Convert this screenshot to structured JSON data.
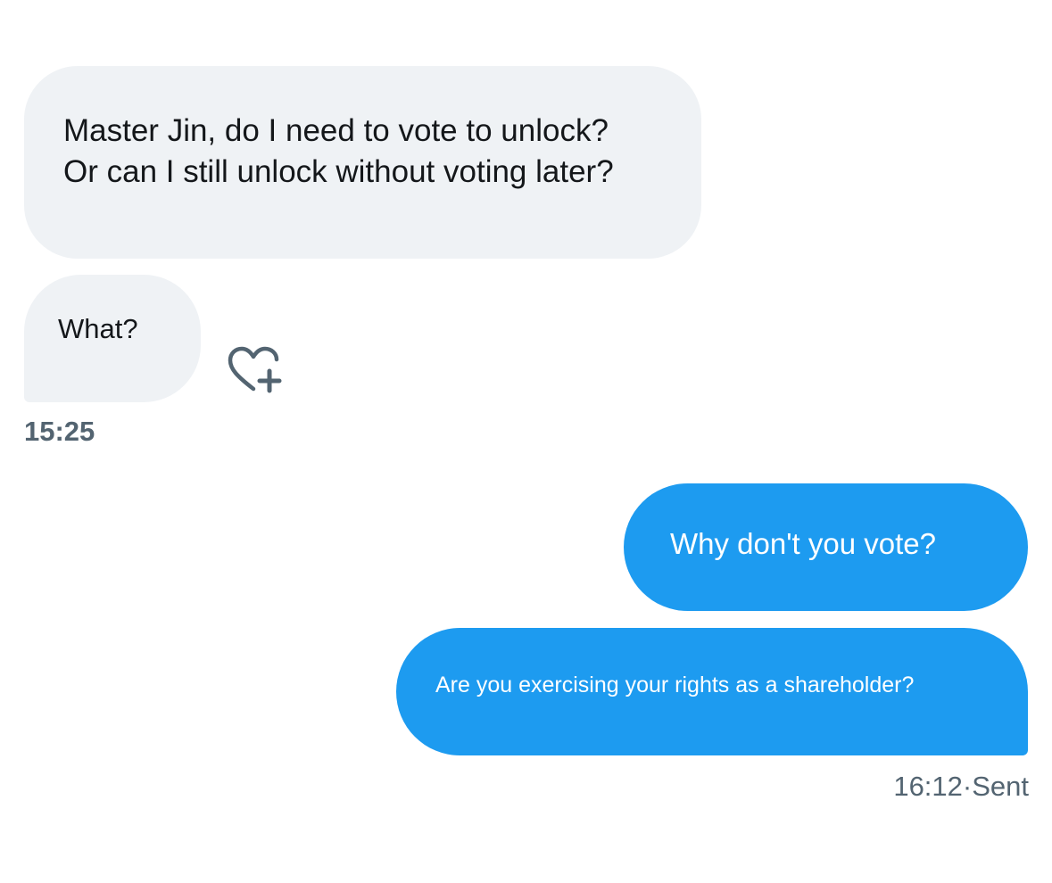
{
  "messages": [
    {
      "direction": "received",
      "text": "Master Jin, do I need to vote to unlock?\nOr can I still unlock without voting later?"
    },
    {
      "direction": "received",
      "text": "What?"
    },
    {
      "direction": "sent",
      "text": "Why don't you vote?"
    },
    {
      "direction": "sent",
      "text": "Are you exercising your rights as a shareholder?"
    }
  ],
  "received_time": "15:25",
  "sent_status": "16:12·Sent",
  "reaction_icon": "heart-plus-icon",
  "colors": {
    "received_bubble": "#eff2f5",
    "sent_bubble": "#1d9bf0",
    "meta_text": "#536471"
  }
}
